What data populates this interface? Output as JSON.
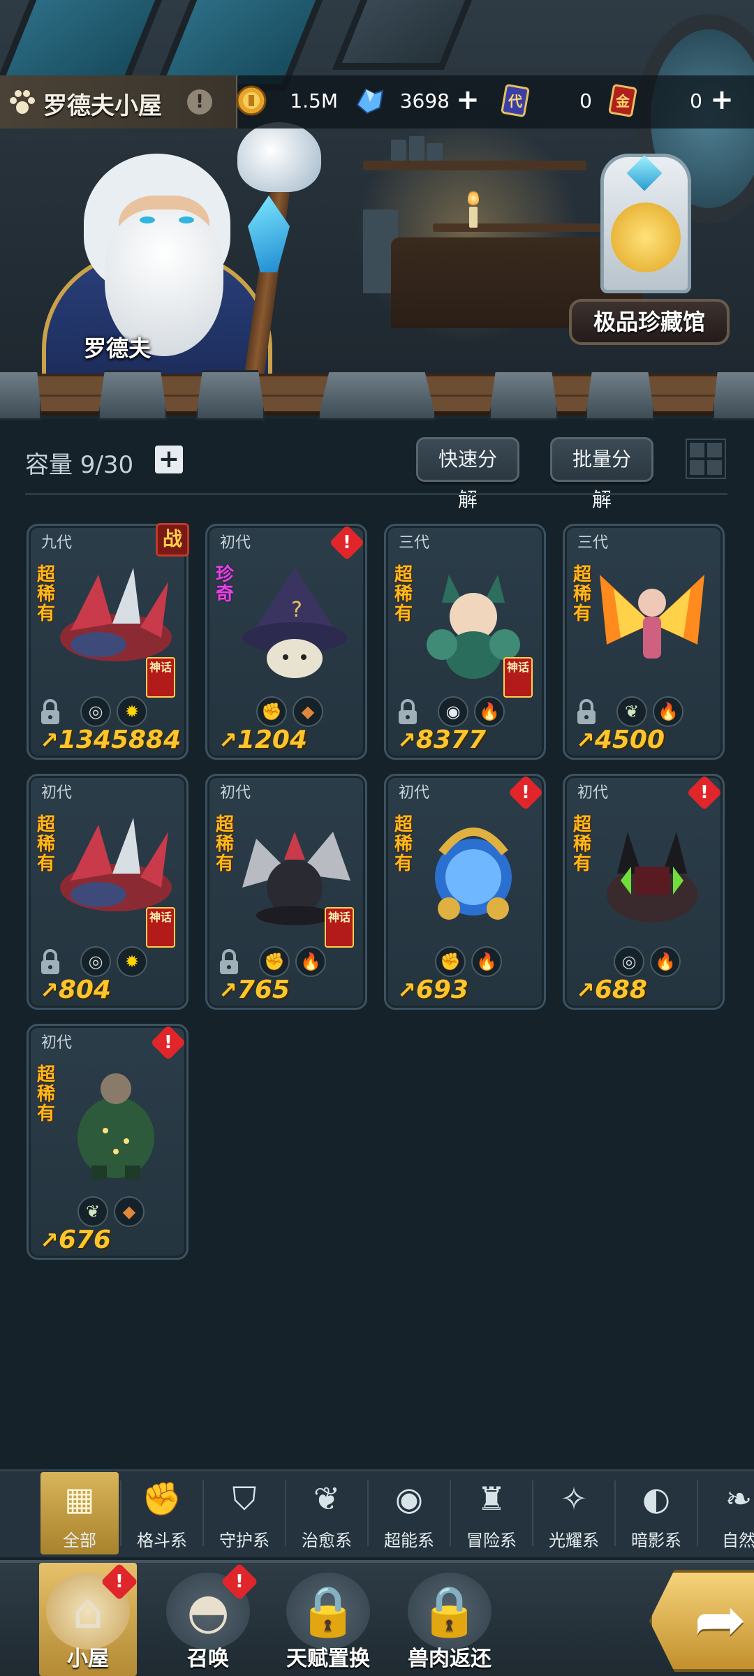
{
  "scene": {
    "npc_name": "罗德夫",
    "collection_hall_label": "极品珍藏馆"
  },
  "header": {
    "title": "罗德夫小屋",
    "info_icon": "exclamation-icon",
    "resources": [
      {
        "name": "gold-coin",
        "value": "1.5M",
        "has_plus": false
      },
      {
        "name": "crystal",
        "value": "3698",
        "has_plus": true
      },
      {
        "name": "generation-card",
        "icon_text": "代",
        "value": "0",
        "has_plus": false
      },
      {
        "name": "gold-card",
        "icon_text": "金",
        "value": "0",
        "has_plus": true
      }
    ]
  },
  "toolbar": {
    "capacity": "容量 9/30",
    "quick_decompose": "快速分解",
    "batch_decompose": "批量分解"
  },
  "pets": [
    {
      "generation": "九代",
      "rarity": "超稀有",
      "rarity_type": "super",
      "badge": "battle",
      "badge_text": "战",
      "locked": true,
      "divine_tag": "神话",
      "elements": [
        "guardian",
        "light"
      ],
      "power": "1345884",
      "creature": "dragon-red"
    },
    {
      "generation": "初代",
      "rarity": "珍奇",
      "rarity_type": "rare",
      "badge": "alert",
      "locked": false,
      "divine_tag": "",
      "elements": [
        "fighting",
        "beast"
      ],
      "power": "1204",
      "creature": "mushroom-wizard"
    },
    {
      "generation": "三代",
      "rarity": "超稀有",
      "rarity_type": "super",
      "badge": "",
      "locked": true,
      "divine_tag": "神话",
      "elements": [
        "psychic",
        "fire"
      ],
      "power": "8377",
      "creature": "fox-girl"
    },
    {
      "generation": "三代",
      "rarity": "超稀有",
      "rarity_type": "super",
      "badge": "",
      "locked": true,
      "divine_tag": "",
      "elements": [
        "healing",
        "fire"
      ],
      "power": "4500",
      "creature": "phoenix-fairy"
    },
    {
      "generation": "初代",
      "rarity": "超稀有",
      "rarity_type": "super",
      "badge": "",
      "locked": true,
      "divine_tag": "神话",
      "elements": [
        "guardian",
        "light"
      ],
      "power": "804",
      "creature": "dragon-red"
    },
    {
      "generation": "初代",
      "rarity": "超稀有",
      "rarity_type": "super",
      "badge": "",
      "locked": true,
      "divine_tag": "神话",
      "elements": [
        "fighting",
        "fire"
      ],
      "power": "765",
      "creature": "black-dragon"
    },
    {
      "generation": "初代",
      "rarity": "超稀有",
      "rarity_type": "super",
      "badge": "alert",
      "locked": false,
      "divine_tag": "",
      "elements": [
        "fighting",
        "fire"
      ],
      "power": "693",
      "creature": "blue-spirit"
    },
    {
      "generation": "初代",
      "rarity": "超稀有",
      "rarity_type": "super",
      "badge": "alert",
      "locked": false,
      "divine_tag": "",
      "elements": [
        "guardian",
        "fire"
      ],
      "power": "688",
      "creature": "dark-beast"
    },
    {
      "generation": "初代",
      "rarity": "超稀有",
      "rarity_type": "super",
      "badge": "alert",
      "locked": false,
      "divine_tag": "",
      "elements": [
        "healing",
        "beast"
      ],
      "power": "676",
      "creature": "tree-golem"
    }
  ],
  "categories": [
    {
      "label": "全部",
      "icon": "all-grid-icon",
      "active": true
    },
    {
      "label": "格斗系",
      "icon": "fist-icon",
      "active": false
    },
    {
      "label": "守护系",
      "icon": "shield-icon",
      "active": false
    },
    {
      "label": "治愈系",
      "icon": "sprout-icon",
      "active": false
    },
    {
      "label": "超能系",
      "icon": "alien-icon",
      "active": false
    },
    {
      "label": "冒险系",
      "icon": "lantern-icon",
      "active": false
    },
    {
      "label": "光耀系",
      "icon": "star-compass-icon",
      "active": false
    },
    {
      "label": "暗影系",
      "icon": "eclipse-icon",
      "active": false
    },
    {
      "label": "自然",
      "icon": "leaf-icon",
      "active": false
    }
  ],
  "tabs": [
    {
      "label": "小屋",
      "icon": "house-icon",
      "active": true,
      "alert": true,
      "locked": false
    },
    {
      "label": "召唤",
      "icon": "egg-icon",
      "active": false,
      "alert": true,
      "locked": false
    },
    {
      "label": "天赋置换",
      "icon": "lock-icon",
      "active": false,
      "alert": false,
      "locked": true
    },
    {
      "label": "兽肉返还",
      "icon": "lock-icon",
      "active": false,
      "alert": false,
      "locked": true
    }
  ],
  "colors": {
    "accent_gold": "#ffc52a",
    "alert_red": "#e0262a",
    "rare_magenta": "#e443e6",
    "card_bg": "#2b3d49"
  }
}
